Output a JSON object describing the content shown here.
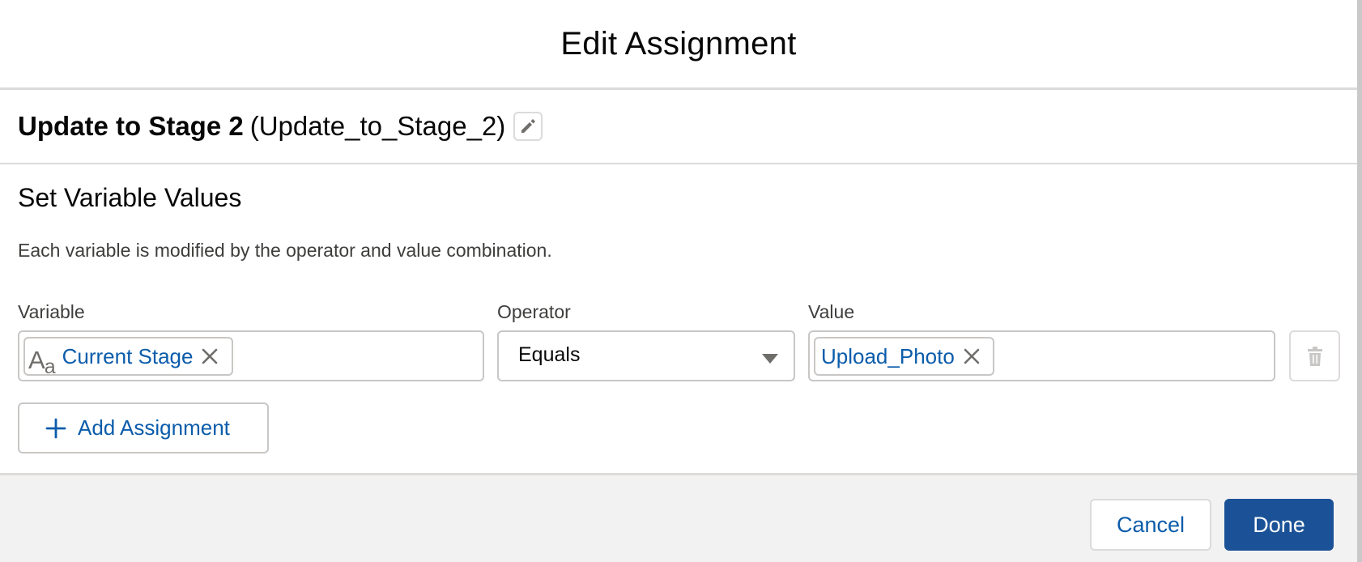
{
  "modal": {
    "title": "Edit Assignment"
  },
  "element": {
    "label": "Update to Stage 2",
    "api_name": "(Update_to_Stage_2)",
    "edit_icon": "pencil-icon"
  },
  "section": {
    "title": "Set Variable Values",
    "description": "Each variable is modified by the operator and value combination."
  },
  "columns": {
    "variable": "Variable",
    "operator": "Operator",
    "value": "Value"
  },
  "assignment": {
    "variable_pill": "Current Stage",
    "variable_icon": "text-type-icon",
    "operator": "Equals",
    "value_pill": "Upload_Photo"
  },
  "actions": {
    "add_assignment": "Add Assignment",
    "cancel": "Cancel",
    "done": "Done"
  },
  "colors": {
    "link": "#0b5cab",
    "brand_button": "#1b5297",
    "footer_bg": "#f3f2f2",
    "border": "#c9c7c5"
  }
}
